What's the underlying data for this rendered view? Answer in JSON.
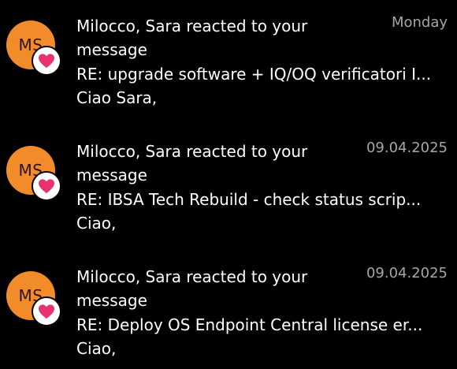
{
  "colors": {
    "background": "#000000",
    "avatar": "#f28b29",
    "reaction_heart": "#e8336d",
    "date_text": "#a6a6a6"
  },
  "messages": [
    {
      "avatar_initials": "MS",
      "reaction_icon": "heart-icon",
      "title": "Milocco, Sara reacted to your message",
      "date": "Monday",
      "subject": "RE: upgrade software + IQ/OQ verificatori I...",
      "preview": "Ciao Sara,"
    },
    {
      "avatar_initials": "MS",
      "reaction_icon": "heart-icon",
      "title": "Milocco, Sara reacted to your message",
      "date": "09.04.2025",
      "subject": "RE: IBSA Tech Rebuild - check status scrip...",
      "preview": "Ciao,"
    },
    {
      "avatar_initials": "MS",
      "reaction_icon": "heart-icon",
      "title": "Milocco, Sara reacted to your message",
      "date": "09.04.2025",
      "subject": "RE: Deploy OS Endpoint Central license er...",
      "preview": "Ciao,"
    }
  ]
}
